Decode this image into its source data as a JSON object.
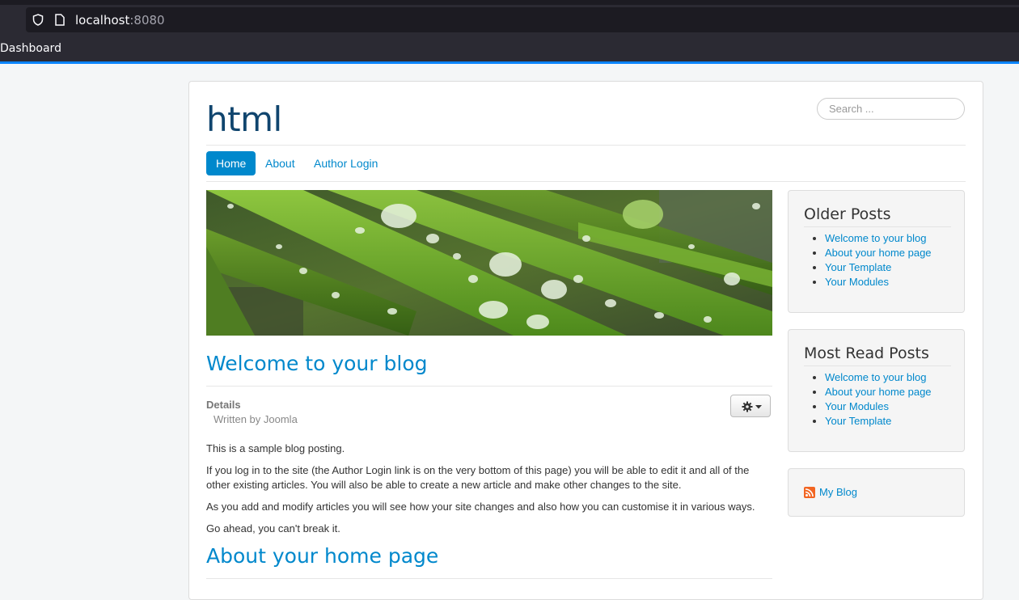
{
  "browser": {
    "url_host": "localhost",
    "url_port": ":8080",
    "bookmark": "Dashboard"
  },
  "site": {
    "title": "html",
    "search_placeholder": "Search ..."
  },
  "nav": {
    "items": [
      "Home",
      "About",
      "Author Login"
    ],
    "active": "Home"
  },
  "articles": [
    {
      "title": "Welcome to your blog",
      "details_label": "Details",
      "author": "Written by Joomla",
      "paragraphs": [
        "This is a sample blog posting.",
        "If you log in to the site (the Author Login link is on the very bottom of this page) you will be able to edit it and all of the other existing articles. You will also be able to create a new article and make other changes to the site.",
        "As you add and modify articles you will see how your site changes and also how you can customise it in various ways.",
        "Go ahead, you can't break it."
      ]
    },
    {
      "title": "About your home page"
    }
  ],
  "sidebar": {
    "older_posts": {
      "title": "Older Posts",
      "items": [
        "Welcome to your blog",
        "About your home page",
        "Your Template",
        "Your Modules"
      ]
    },
    "most_read": {
      "title": "Most Read Posts",
      "items": [
        "Welcome to your blog",
        "About your home page",
        "Your Modules",
        "Your Template"
      ]
    },
    "feed": {
      "label": "My Blog",
      "icon": "rss-icon"
    }
  },
  "colors": {
    "accent": "#0088cc",
    "title": "#10456e",
    "browser_accent": "#0a84ff"
  }
}
